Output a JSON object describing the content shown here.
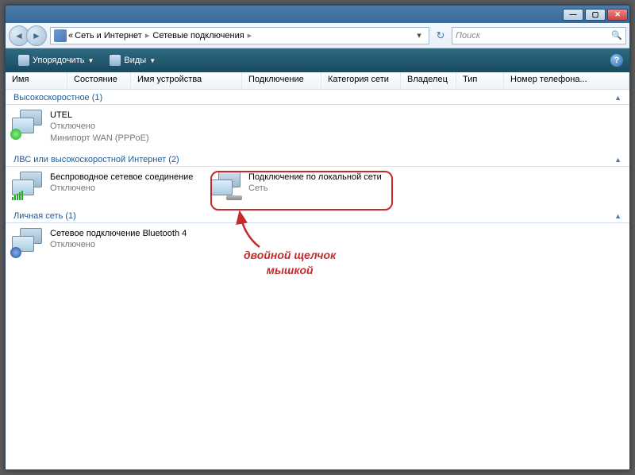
{
  "titlebar": {
    "min": "—",
    "max": "▢",
    "close": "✕"
  },
  "breadcrumb": {
    "prefix": "«",
    "seg1": "Сеть и Интернет",
    "seg2": "Сетевые подключения"
  },
  "search": {
    "placeholder": "Поиск"
  },
  "toolbar": {
    "organize": "Упорядочить",
    "views": "Виды"
  },
  "columns": {
    "name": "Имя",
    "status": "Состояние",
    "device": "Имя устройства",
    "connection": "Подключение",
    "category": "Категория сети",
    "owner": "Владелец",
    "type": "Тип",
    "phone": "Номер телефона..."
  },
  "groups": [
    {
      "header": "Высокоскоростное (1)",
      "items": [
        {
          "name": "UTEL",
          "line2": "Отключено",
          "line3": "Минипорт WAN (PPPoE)",
          "badge": "ok"
        }
      ]
    },
    {
      "header": "ЛВС или высокоскоростной Интернет (2)",
      "items": [
        {
          "name": "Беспроводное сетевое соединение",
          "line2": "Отключено",
          "line3": "",
          "badge": "bars"
        },
        {
          "name": "Подключение по локальной сети",
          "line2": "Сеть",
          "line3": "",
          "badge": "cable",
          "highlighted": true
        }
      ]
    },
    {
      "header": "Личная сеть (1)",
      "items": [
        {
          "name": "Сетевое подключение Bluetooth 4",
          "line2": "Отключено",
          "line3": "",
          "badge": "bt"
        }
      ]
    }
  ],
  "annotation": {
    "line1": "двойной щелчок",
    "line2": "мышкой"
  }
}
